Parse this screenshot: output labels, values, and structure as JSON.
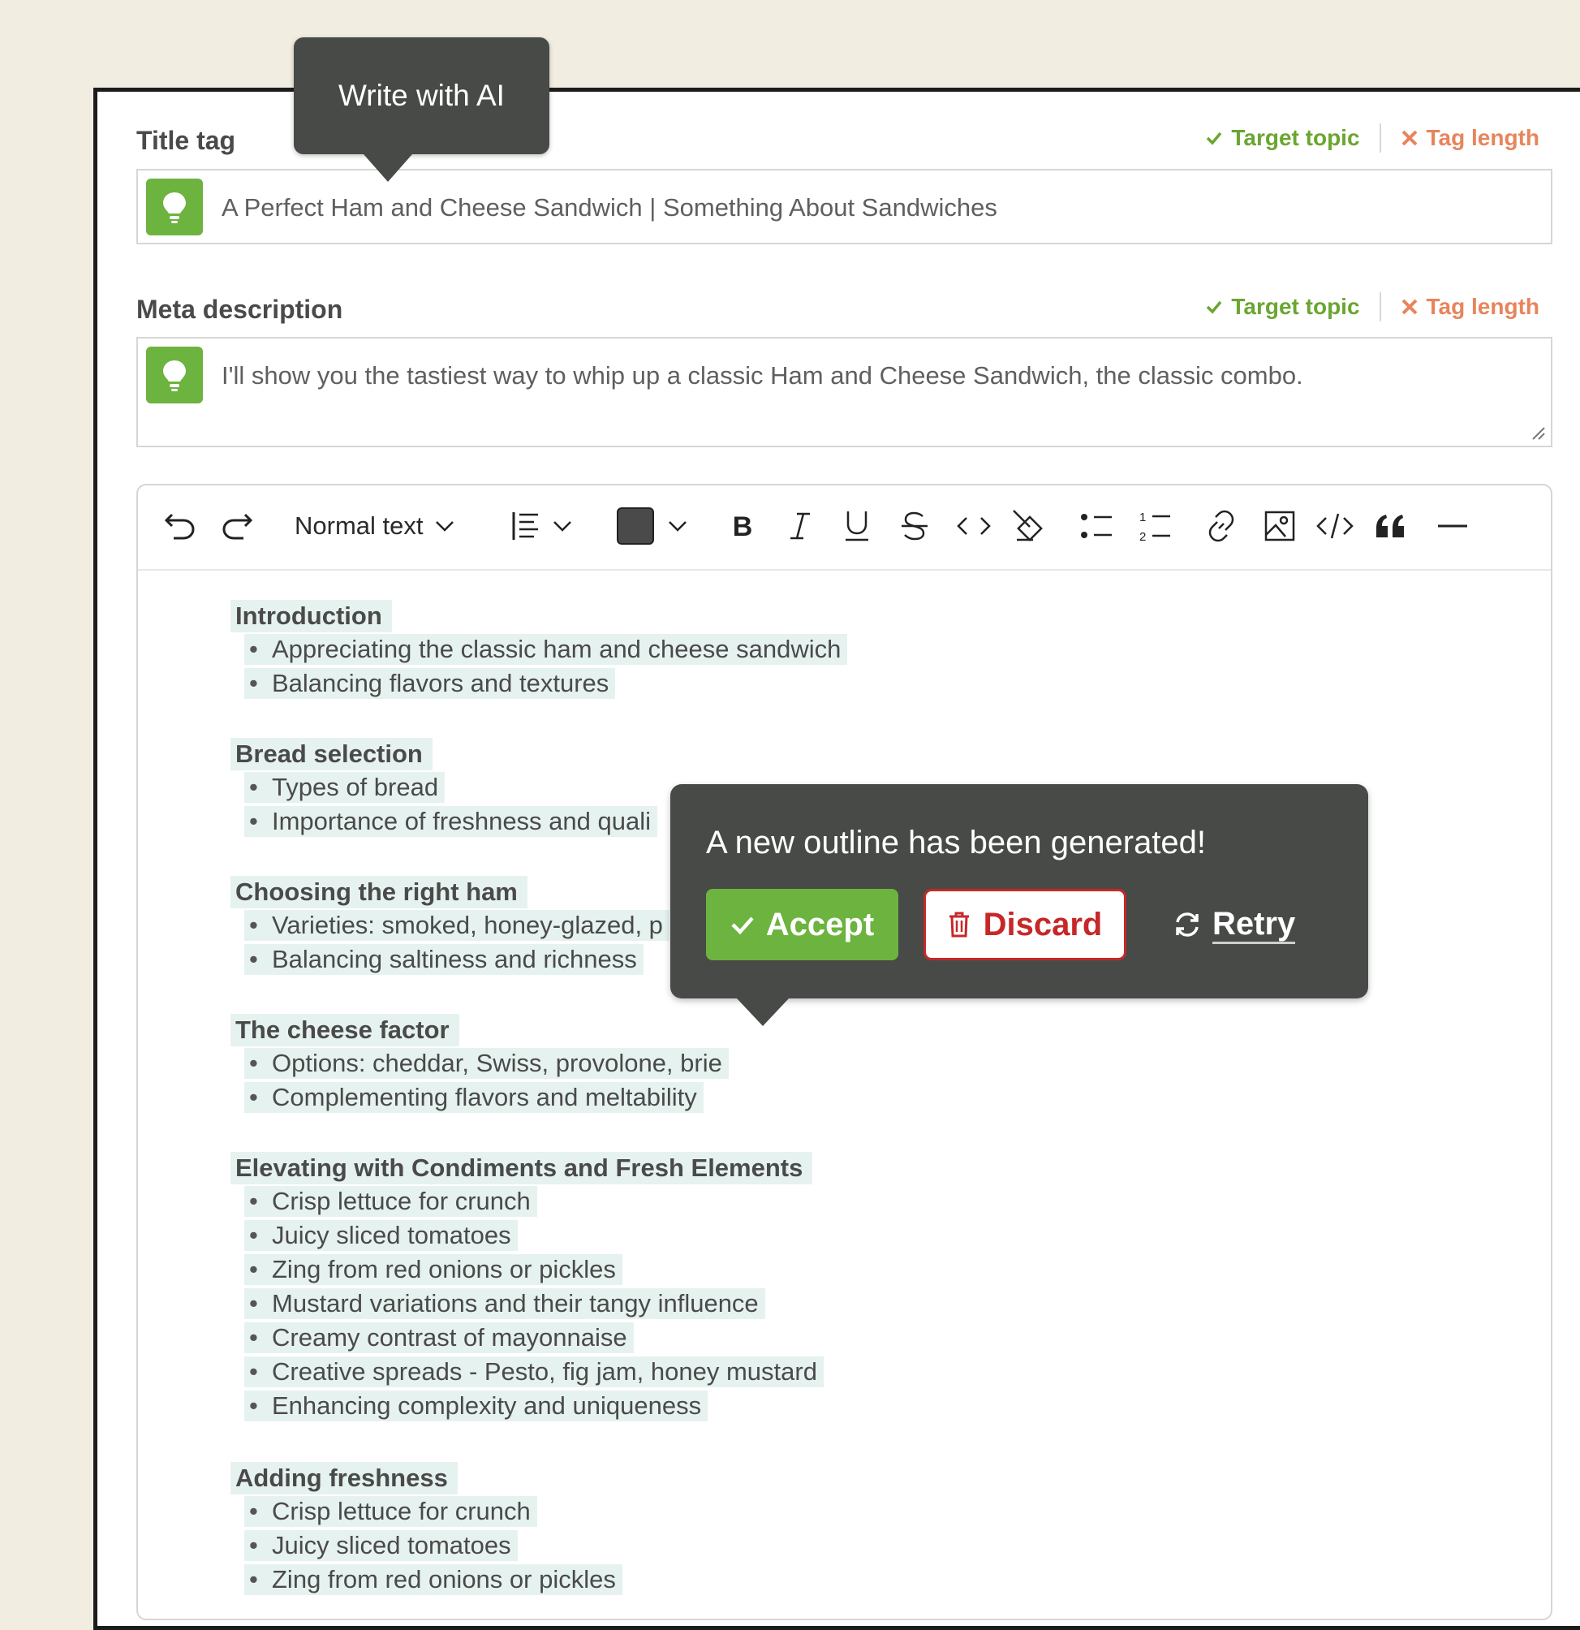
{
  "tooltip": {
    "text": "Write with AI"
  },
  "title_field": {
    "label": "Title tag",
    "value": "A Perfect Ham and Cheese Sandwich | Something About Sandwiches",
    "check_ok": "Target topic",
    "check_bad": "Tag length"
  },
  "meta_field": {
    "label": "Meta description",
    "value": "I'll show you the tastiest way to whip up a classic Ham and Cheese Sandwich, the classic combo.",
    "check_ok": "Target topic",
    "check_bad": "Tag length"
  },
  "toolbar": {
    "text_style": "Normal text",
    "color_swatch": "#4a4a4a",
    "icons": [
      "undo-icon",
      "redo-icon",
      "align-icon",
      "bold-icon",
      "italic-icon",
      "underline-icon",
      "strikethrough-icon",
      "inline-code-icon",
      "clear-format-icon",
      "bullet-list-icon",
      "numbered-list-icon",
      "link-icon",
      "image-icon",
      "code-block-icon",
      "quote-icon",
      "horizontal-rule-icon"
    ]
  },
  "outline": [
    {
      "heading": "Introduction",
      "items": [
        "Appreciating the classic ham and cheese sandwich",
        "Balancing flavors and textures"
      ]
    },
    {
      "heading": "Bread selection",
      "items": [
        "Types of bread",
        "Importance of freshness and quali"
      ]
    },
    {
      "heading": "Choosing the right ham",
      "items": [
        "Varieties: smoked, honey-glazed, p",
        "Balancing saltiness and richness"
      ]
    },
    {
      "heading": "The cheese factor",
      "items": [
        "Options: cheddar, Swiss, provolone, brie",
        "Complementing flavors and meltability"
      ]
    },
    {
      "heading": "Elevating with Condiments and Fresh Elements",
      "items": [
        "Crisp lettuce for crunch",
        "Juicy sliced tomatoes",
        "Zing from red onions or pickles",
        "Mustard variations and their tangy influence",
        "Creamy contrast of mayonnaise",
        "Creative spreads - Pesto, fig jam, honey mustard",
        "Enhancing complexity and uniqueness"
      ]
    },
    {
      "heading": "Adding freshness",
      "items": [
        "Crisp lettuce for crunch",
        "Juicy sliced tomatoes",
        "Zing from red onions or pickles"
      ]
    }
  ],
  "popup": {
    "message": "A new outline has been generated!",
    "accept": "Accept",
    "discard": "Discard",
    "retry": "Retry"
  },
  "colors": {
    "accent_green": "#6cb33f",
    "warn_orange": "#e8845c",
    "danger_red": "#c62828",
    "dark_panel": "#474a47",
    "highlight": "#e6f2ef"
  }
}
